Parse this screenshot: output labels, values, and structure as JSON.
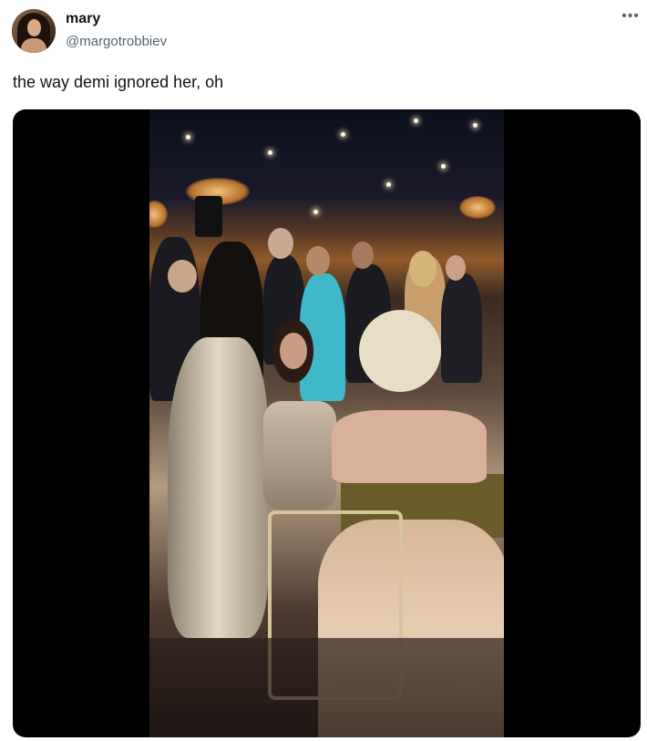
{
  "user": {
    "display_name": "mary",
    "handle": "@margotrobbiev"
  },
  "more_icon": "more-horizontal-icon",
  "tweet": {
    "text": "the way demi ignored her, oh"
  },
  "media": {
    "type": "video-still",
    "background_color": "#000000"
  }
}
